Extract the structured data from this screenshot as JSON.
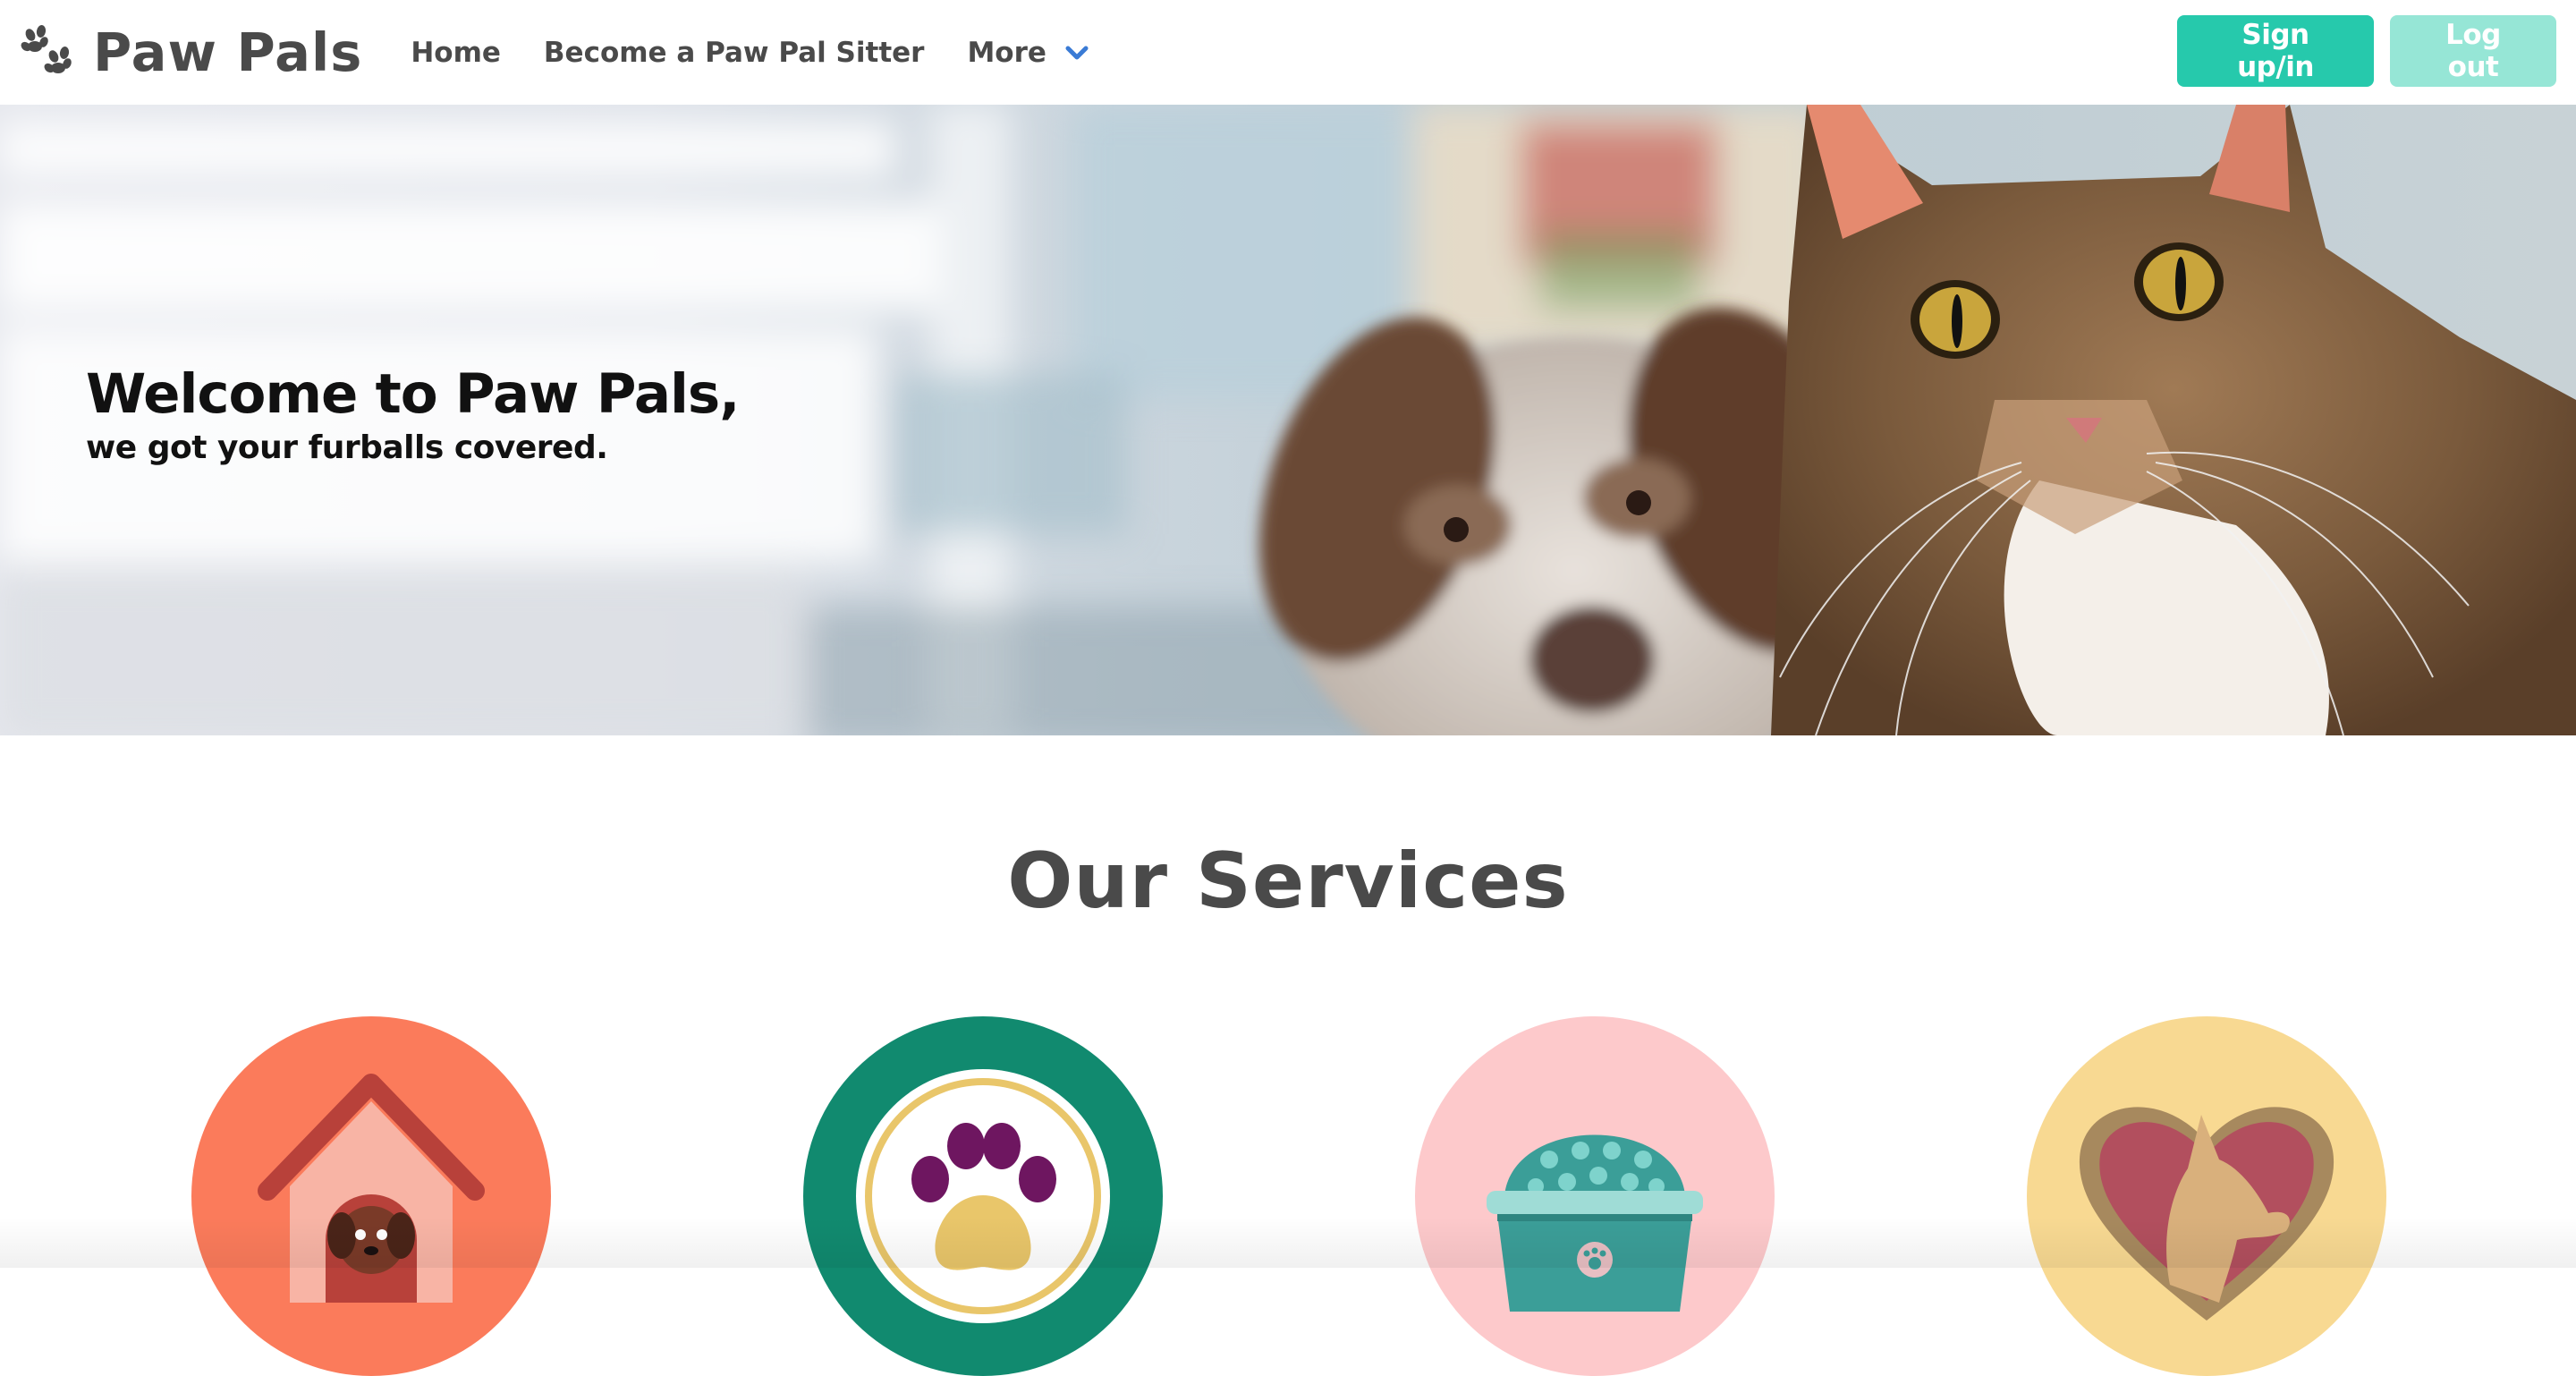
{
  "brand": {
    "name": "Paw Pals",
    "icon": "paw-print-icon"
  },
  "nav": {
    "home": "Home",
    "become_sitter": "Become a Paw Pal Sitter",
    "more": "More"
  },
  "auth": {
    "sign_label": "Sign up/in",
    "logout_label": "Log out"
  },
  "hero": {
    "title": "Welcome to Paw Pals,",
    "subtitle": "we got your furballs covered."
  },
  "services": {
    "heading": "Our Services",
    "icons": [
      "dog-house-icon",
      "paw-badge-icon",
      "food-bowl-icon",
      "pet-heart-icon"
    ]
  },
  "colors": {
    "primary": "#26c9ac",
    "primary_light": "#96e6d6",
    "text": "#4a4a4a",
    "chevron": "#3a7bd5",
    "service_1": "#fb7b5b",
    "service_2": "#118a6f",
    "service_3": "#fdc9cb",
    "service_4": "#f8d992"
  }
}
